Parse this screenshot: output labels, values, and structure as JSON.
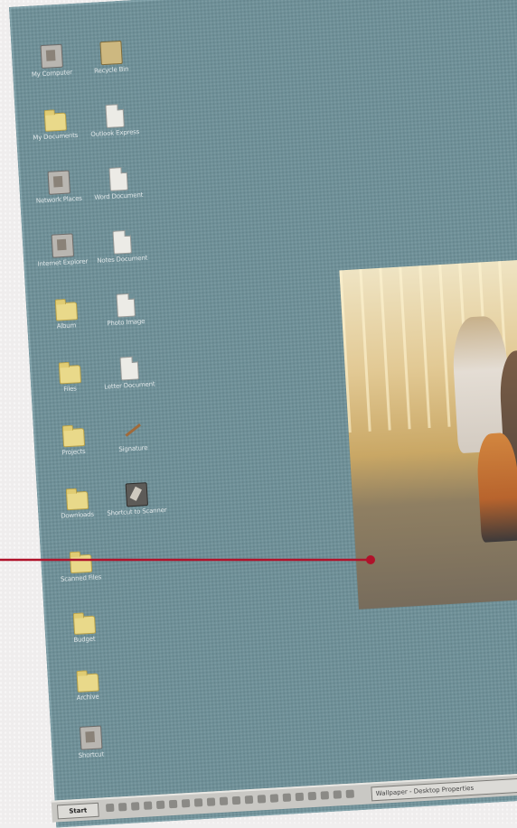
{
  "desktop": {
    "icons": [
      {
        "label": "My Computer",
        "type": "app"
      },
      {
        "label": "Recycle Bin",
        "type": "gold"
      },
      {
        "label": "My Documents",
        "type": "folder"
      },
      {
        "label": "Outlook Express",
        "type": "doc"
      },
      {
        "label": "Network Places",
        "type": "app"
      },
      {
        "label": "Word Document",
        "type": "doc"
      },
      {
        "label": "Internet Explorer",
        "type": "app"
      },
      {
        "label": "Notes Document",
        "type": "doc"
      },
      {
        "label": "Album",
        "type": "folder"
      },
      {
        "label": "Photo Image",
        "type": "doc"
      },
      {
        "label": "Files",
        "type": "folder"
      },
      {
        "label": "Letter Document",
        "type": "doc"
      },
      {
        "label": "Projects",
        "type": "folder"
      },
      {
        "label": "Signature",
        "type": "pen"
      },
      {
        "label": "Downloads",
        "type": "folder"
      },
      {
        "label": "Shortcut to Scanner",
        "type": "dark"
      },
      {
        "label": "Scanned Files",
        "type": "folder"
      },
      {
        "label": "Budget",
        "type": "folder"
      },
      {
        "label": "Archive",
        "type": "folder"
      },
      {
        "label": "Shortcut",
        "type": "app"
      }
    ]
  },
  "taskbar": {
    "start_label": "Start",
    "window_label": "Wallpaper - Desktop Properties"
  },
  "colors": {
    "desktop": "#6f9098",
    "callout": "#b0122a",
    "taskbar": "#c9c8c4"
  }
}
